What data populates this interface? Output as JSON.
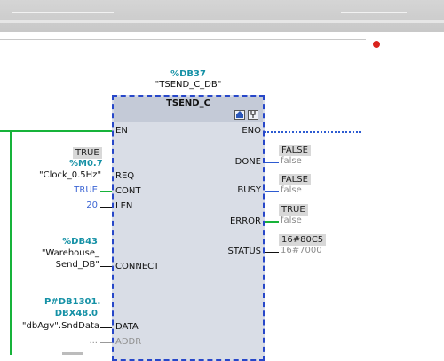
{
  "block": {
    "instance_db": "%DB37",
    "instance_name": "\"TSEND_C_DB\"",
    "type_name": "TSEND_C",
    "icons": [
      "upload-icon",
      "network-cable-icon"
    ]
  },
  "inputs": {
    "en": {
      "pin": "EN"
    },
    "req": {
      "status": "TRUE",
      "address": "%M0.7",
      "tag": "\"Clock_0.5Hz\"",
      "pin": "REQ"
    },
    "cont": {
      "value": "TRUE",
      "pin": "CONT"
    },
    "len": {
      "value": "20",
      "pin": "LEN"
    },
    "connect": {
      "address": "%DB43",
      "tag_line1": "\"Warehouse_",
      "tag_line2": "Send_DB\"",
      "pin": "CONNECT"
    },
    "data": {
      "address_line1": "P#DB1301.",
      "address_line2": "DBX48.0",
      "tag": "\"dbAgv\".SndData",
      "pin": "DATA"
    },
    "addr": {
      "value": "...",
      "pin": "ADDR"
    }
  },
  "outputs": {
    "eno": {
      "pin": "ENO"
    },
    "done": {
      "pin": "DONE",
      "status": "FALSE",
      "value": "false"
    },
    "busy": {
      "pin": "BUSY",
      "status": "FALSE",
      "value": "false"
    },
    "error": {
      "pin": "ERROR",
      "status": "TRUE",
      "value": "false"
    },
    "status": {
      "pin": "STATUS",
      "status": "16#80C5",
      "value": "16#7000"
    }
  },
  "colors": {
    "active_signal": "#17b33a",
    "block_border": "#2747c9",
    "address_teal": "#1591a6",
    "true_value_blue": "#3d66d4"
  }
}
